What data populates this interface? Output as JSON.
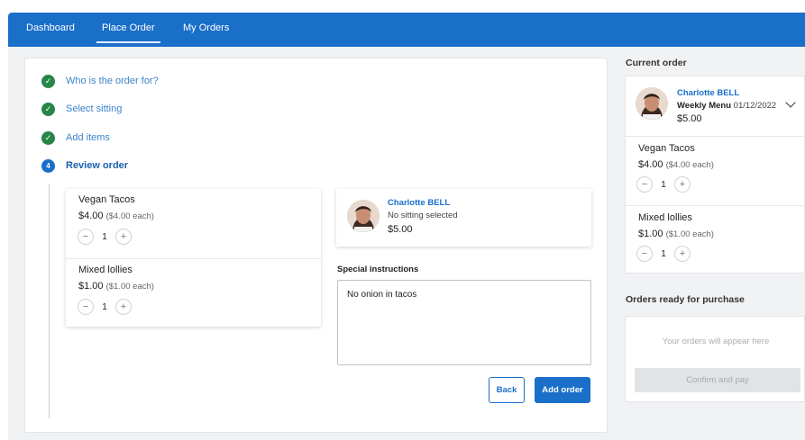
{
  "nav": {
    "tabs": [
      {
        "label": "Dashboard"
      },
      {
        "label": "Place Order"
      },
      {
        "label": "My Orders"
      }
    ],
    "active_tab": "Place Order"
  },
  "steps": [
    {
      "label": "Who is the order for?",
      "status": "done"
    },
    {
      "label": "Select sitting",
      "status": "done"
    },
    {
      "label": "Add items",
      "status": "done"
    },
    {
      "label": "Review order",
      "status": "active",
      "number": "4"
    }
  ],
  "review": {
    "items": [
      {
        "name": "Vegan Tacos",
        "price": "$4.00",
        "each": "($4.00 each)",
        "qty": "1"
      },
      {
        "name": "Mixed lollies",
        "price": "$1.00",
        "each": "($1.00 each)",
        "qty": "1"
      }
    ],
    "person": {
      "name": "Charlotte BELL",
      "sitting": "No sitting selected",
      "total": "$5.00"
    },
    "special_instructions_label": "Special instructions",
    "special_instructions_value": "No onion in tacos",
    "back_label": "Back",
    "add_order_label": "Add order"
  },
  "current_order": {
    "title": "Current order",
    "name": "Charlotte BELL",
    "menu": "Weekly Menu",
    "date": "01/12/2022",
    "total": "$5.00",
    "items": [
      {
        "name": "Vegan Tacos",
        "price": "$4.00",
        "each": "($4.00 each)",
        "qty": "1"
      },
      {
        "name": "Mixed lollies",
        "price": "$1.00",
        "each": "($1.00 each)",
        "qty": "1"
      }
    ]
  },
  "ready": {
    "title": "Orders ready for purchase",
    "empty_text": "Your orders will appear here",
    "confirm_label": "Confirm and pay"
  },
  "colors": {
    "primary": "#1a6fc9",
    "success": "#28854a"
  }
}
